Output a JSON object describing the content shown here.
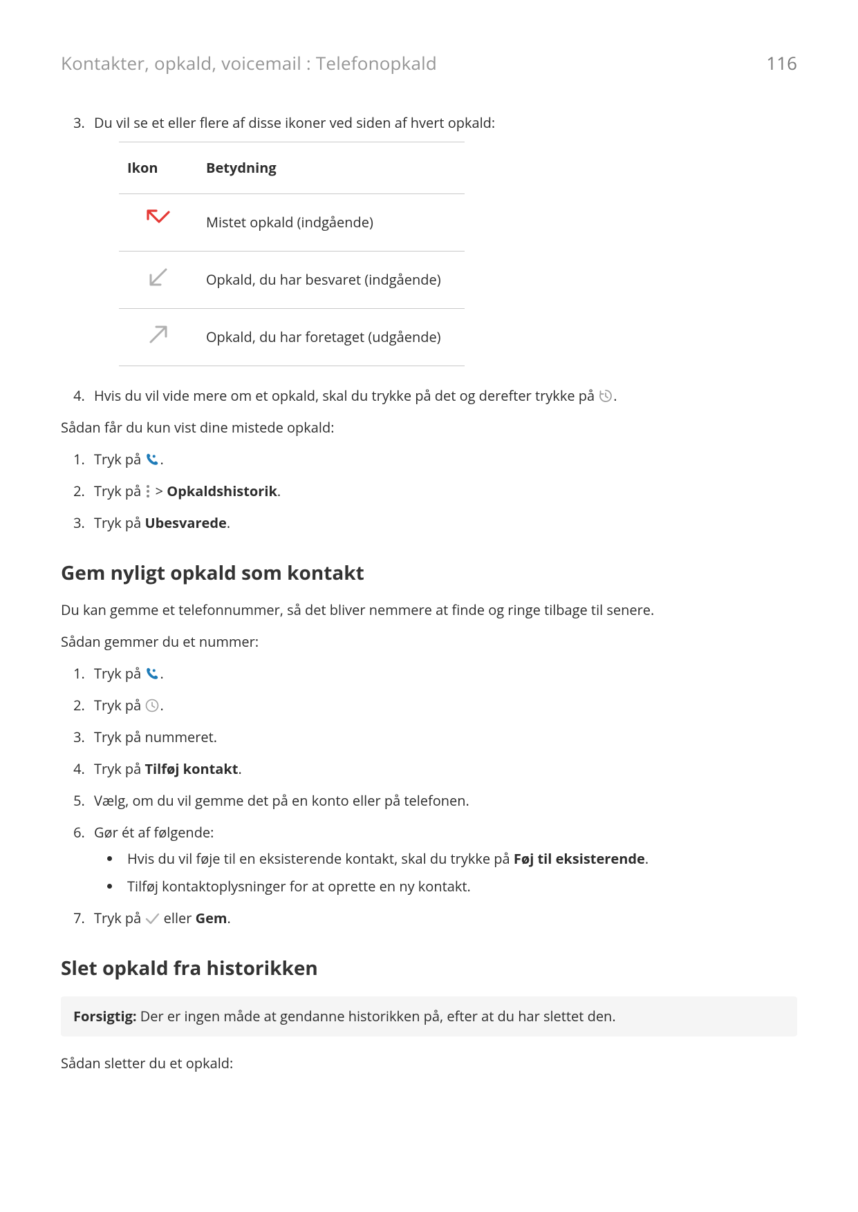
{
  "header": {
    "breadcrumb": "Kontakter, opkald, voicemail : Telefonopkald",
    "page_number": "116"
  },
  "top_steps": {
    "s3": {
      "number": "3.",
      "text": "Du vil se et eller flere af disse ikoner ved siden af hvert opkald:"
    },
    "table": {
      "col_icon": "Ikon",
      "col_meaning": "Betydning",
      "row1": "Mistet opkald (indgående)",
      "row2": "Opkald, du har besvaret (indgående)",
      "row3": "Opkald, du har foretaget (udgående)"
    },
    "s4": {
      "number": "4.",
      "before": "Hvis du vil vide mere om et opkald, skal du trykke på det og derefter trykke på ",
      "after": "."
    }
  },
  "missed_intro": "Sådan får du kun vist dine mistede opkald:",
  "missed_steps": {
    "s1": {
      "number": "1.",
      "before": "Tryk på ",
      "after": "."
    },
    "s2": {
      "number": "2.",
      "before": "Tryk på ",
      "mid": " > ",
      "bold": "Opkaldshistorik",
      "after": "."
    },
    "s3": {
      "number": "3.",
      "before": "Tryk på ",
      "bold": "Ubesvarede",
      "after": "."
    }
  },
  "save_section": {
    "title": "Gem nyligt opkald som kontakt",
    "intro1": "Du kan gemme et telefonnummer, så det bliver nemmere at finde og ringe tilbage til senere.",
    "intro2": "Sådan gemmer du et nummer:",
    "s1": {
      "number": "1.",
      "before": "Tryk på ",
      "after": "."
    },
    "s2": {
      "number": "2.",
      "before": "Tryk på ",
      "after": "."
    },
    "s3": {
      "number": "3.",
      "text": "Tryk på nummeret."
    },
    "s4": {
      "number": "4.",
      "before": "Tryk på ",
      "bold": "Tilføj kontakt",
      "after": "."
    },
    "s5": {
      "number": "5.",
      "text": "Vælg, om du vil gemme det på en konto eller på telefonen."
    },
    "s6": {
      "number": "6.",
      "text": "Gør ét af følgende:",
      "b1_before": "Hvis du vil føje til en eksisterende kontakt, skal du trykke på ",
      "b1_bold": "Føj til eksisterende",
      "b1_after": ".",
      "b2": "Tilføj kontaktoplysninger for at oprette en ny kontakt."
    },
    "s7": {
      "number": "7.",
      "before": "Tryk på ",
      "mid": " eller ",
      "bold": "Gem",
      "after": "."
    }
  },
  "delete_section": {
    "title": "Slet opkald fra historikken",
    "caution_label": "Forsigtig:",
    "caution_text": " Der er ingen måde at gendanne historikken på, efter at du har slettet den.",
    "intro": "Sådan sletter du et opkald:"
  }
}
